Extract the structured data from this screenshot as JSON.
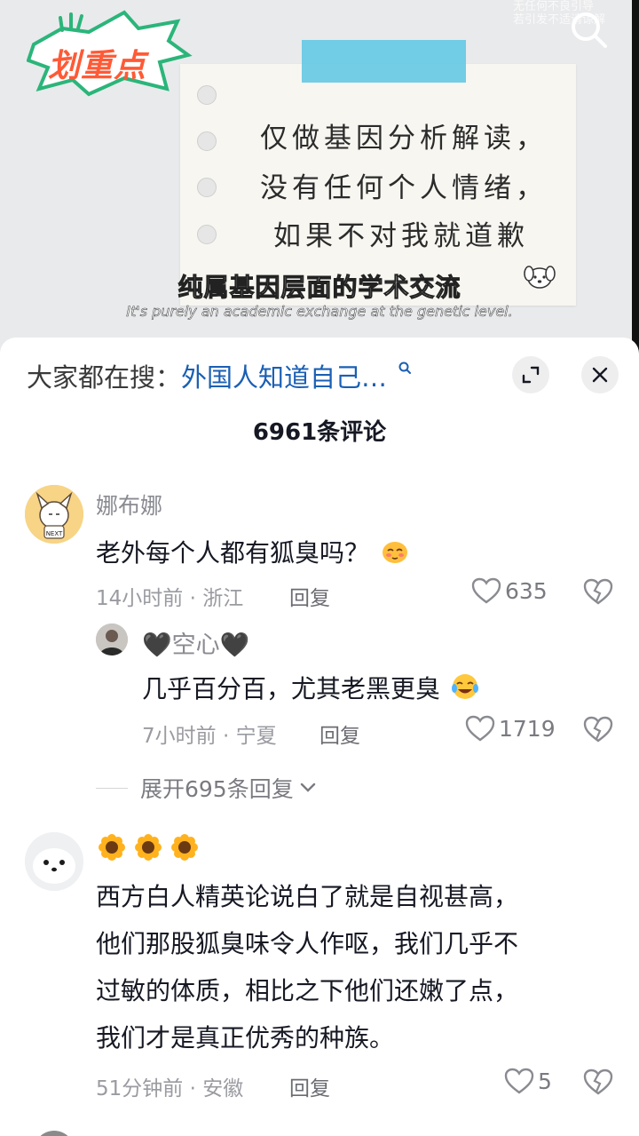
{
  "video": {
    "badge_label": "划重点",
    "note_lines": [
      "仅做基因分析解读，",
      "没有任何个人情绪，",
      "如果不对我就道歉"
    ],
    "subtitle_cn": "纯属基因层面的学术交流",
    "subtitle_en": "It's purely an academic exchange at the genetic level.",
    "watermark_line1": "无任何不良引导",
    "watermark_line2": "若引发不适请谅解"
  },
  "search_bar": {
    "prefix": "大家都在搜：",
    "keyword": "外国人知道自己…"
  },
  "comments_header": {
    "title": "6961条评论"
  },
  "comments": [
    {
      "username": "娜布娜",
      "text": "老外每个人都有狐臭吗？",
      "meta": "14小时前 · 浙江",
      "reply_label": "回复",
      "likes": "635",
      "replies": [
        {
          "username": "🖤空心🖤",
          "text": "几乎百分百，尤其老黑更臭",
          "meta": "7小时前 · 宁夏",
          "reply_label": "回复",
          "likes": "1719"
        }
      ],
      "expand_label": "展开695条回复"
    },
    {
      "username": "",
      "text_lines": [
        "西方白人精英论说白了就是自视甚高，",
        "他们那股狐臭味令人作呕，我们几乎不",
        "过敏的体质，相比之下他们还嫩了点，",
        "我们才是真正优秀的种族。"
      ],
      "meta": "51分钟前 · 安徽",
      "reply_label": "回复",
      "likes": "5"
    }
  ],
  "icons": {
    "close": "close-icon",
    "expand": "expand-icon",
    "heart": "heart-icon",
    "broken_heart": "broken-heart-icon",
    "search": "search-icon",
    "sunflower": "sunflower-emoji"
  },
  "colors": {
    "keyword": "#1a5fb4",
    "badge_orange": "#ff5a36",
    "badge_green": "#3cc98c",
    "tape_blue": "#66c9e4"
  }
}
